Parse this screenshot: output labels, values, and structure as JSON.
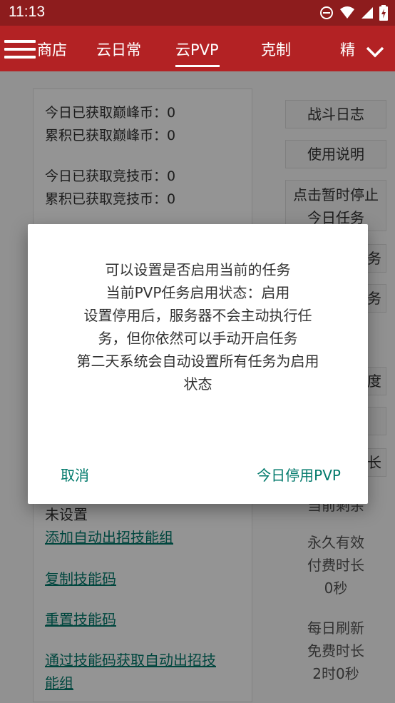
{
  "status_bar": {
    "time": "11:13"
  },
  "tabs": [
    {
      "label": "商店"
    },
    {
      "label": "云日常"
    },
    {
      "label": "云PVP"
    },
    {
      "label": "克制"
    },
    {
      "label": "精"
    }
  ],
  "left": {
    "stats": [
      "今日已获取巅峰币：0",
      "累积已获取巅峰币：0",
      "今日已获取竞技币：0",
      "累积已获取竞技币：0"
    ],
    "not_set": "未设置",
    "links": {
      "add_skill_group": "添加自动出招技能组",
      "copy_code": "复制技能码",
      "reset_code": "重置技能码",
      "get_by_code_1": "通过技能码获取自动出招技",
      "get_by_code_2": "能组"
    }
  },
  "right": {
    "battle_log": "战斗日志",
    "usage": "使用说明",
    "pause_1": "点击暂时停止",
    "pause_2": "今日任务",
    "partial_1": "务",
    "partial_2": "务",
    "partial_3": "度",
    "partial_4": "长",
    "current_remain": "当前剩余",
    "permanent": "永久有效",
    "paid_time": "付费时长",
    "paid_value": "0秒",
    "daily_refresh": "每日刷新",
    "free_time": "免费时长",
    "free_value": "2时0秒"
  },
  "dialog": {
    "line1": "可以设置是否启用当前的任务",
    "line2": "当前PVP任务启用状态：启用",
    "line3": "设置停用后，服务器不会主动执行任",
    "line4": "务，但你依然可以手动开启任务",
    "line5": "第二天系统会自动设置所有任务为启用",
    "line6": "状态",
    "cancel": "取消",
    "confirm": "今日停用PVP"
  }
}
